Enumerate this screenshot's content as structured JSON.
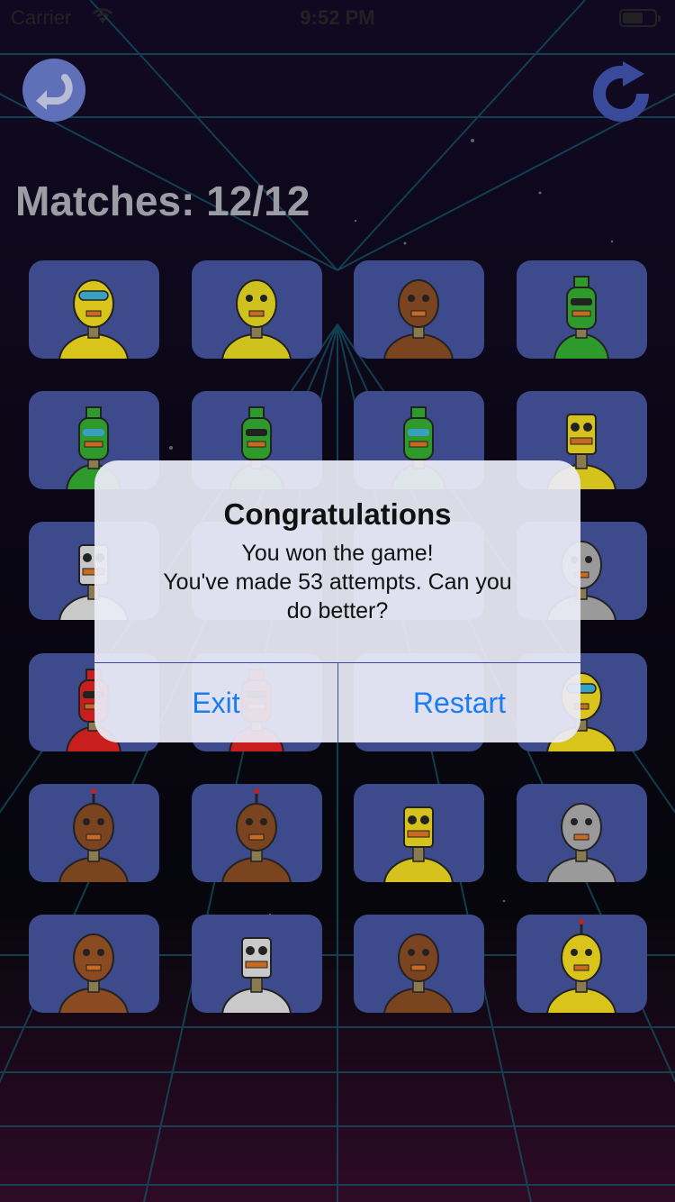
{
  "status": {
    "carrier": "Carrier",
    "time": "9:52 PM"
  },
  "score": {
    "label": "Matches:",
    "value": "12/12"
  },
  "alert": {
    "title": "Congratulations",
    "message_lines": [
      "You won the game!",
      "You've made 53 attempts. Can you",
      "do better?"
    ],
    "exit_label": "Exit",
    "restart_label": "Restart"
  },
  "tiles": [
    {
      "robot": "yellow-round-visor-robot",
      "color": "#d9c41c"
    },
    {
      "robot": "yellow-round-robot",
      "color": "#cfc21e"
    },
    {
      "robot": "brown-bot-robot",
      "color": "#7a4420"
    },
    {
      "robot": "green-bottle-robot",
      "color": "#2f9a2c"
    },
    {
      "robot": "green-bottle-visor-robot",
      "color": "#2f9a2c"
    },
    {
      "robot": "green-bottle-robot",
      "color": "#2f9a2c"
    },
    {
      "robot": "green-bottle-visor-robot",
      "color": "#2f9a2c"
    },
    {
      "robot": "yellow-can-robot",
      "color": "#d6c21c"
    },
    {
      "robot": "silver-can-robot",
      "color": "#c9c9c9"
    },
    {
      "robot": "hidden-tile",
      "color": "#3d4b8c"
    },
    {
      "robot": "hidden-tile",
      "color": "#3d4b8c"
    },
    {
      "robot": "silver-round-robot",
      "color": "#9a9a9a"
    },
    {
      "robot": "red-bottle-robot",
      "color": "#c81e1e"
    },
    {
      "robot": "red-bottle-robot",
      "color": "#c81e1e"
    },
    {
      "robot": "hidden-tile",
      "color": "#3d4b8c"
    },
    {
      "robot": "yellow-round-visor-robot",
      "color": "#d9c41c"
    },
    {
      "robot": "brown-antenna-robot",
      "color": "#7a4420"
    },
    {
      "robot": "brown-antenna-robot",
      "color": "#7a4420"
    },
    {
      "robot": "yellow-can-robot",
      "color": "#d6c21c"
    },
    {
      "robot": "silver-round-robot",
      "color": "#9a9a9a"
    },
    {
      "robot": "brown-heart-robot",
      "color": "#8a4a22"
    },
    {
      "robot": "silver-can-robot",
      "color": "#c9c9c9"
    },
    {
      "robot": "brown-bot-robot",
      "color": "#7a4420"
    },
    {
      "robot": "yellow-antenna-robot",
      "color": "#d9c41c"
    }
  ]
}
